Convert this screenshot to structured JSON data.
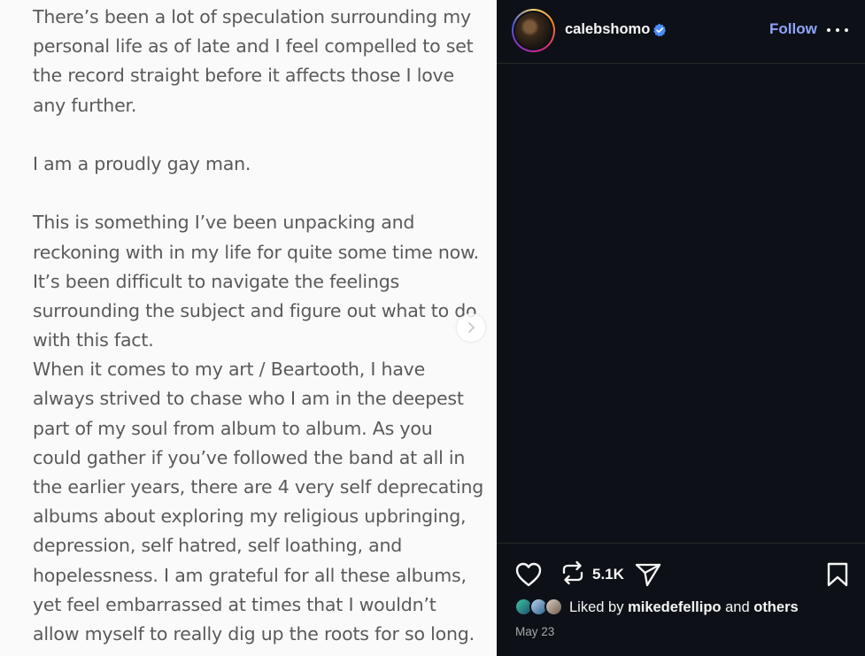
{
  "post": {
    "note_lines": [
      "There’s been a lot of speculation surrounding my",
      "personal life as of late and I feel compelled to set",
      "the record straight before it affects those I love",
      "any further.",
      "",
      "I am a proudly gay man.",
      "",
      "This is something I’ve been unpacking and",
      "reckoning with in my life for quite some time now.",
      "It’s been difficult to navigate the feelings",
      "surrounding the subject and figure out what to do",
      "with this fact.",
      "When it comes to my art / Beartooth, I have",
      "always strived to chase who I am in the deepest",
      "part of my soul from album to album. As you",
      "could gather if you’ve followed the band at all in",
      "the earlier years, there are 4 very self deprecating",
      "albums about exploring my religious upbringing,",
      "depression, self hatred, self loathing, and",
      "hopelessness. I am grateful for all these albums,",
      "yet feel embarrassed at times that I wouldn’t",
      "allow myself to really dig up the roots for so long."
    ],
    "next_icon": "chevron-right-icon"
  },
  "header": {
    "username": "calebshomo",
    "verified_icon": "verified-badge-icon",
    "follow_label": "Follow",
    "more_icon": "more-options-icon"
  },
  "actions": {
    "like_icon": "heart-icon",
    "repost_icon": "repost-icon",
    "repost_count": "5.1K",
    "share_icon": "send-icon",
    "save_icon": "bookmark-icon"
  },
  "likes": {
    "prefix": "Liked by",
    "user": "mikedefellipo",
    "middle": "and",
    "others": "others"
  },
  "date": "May 23",
  "colors": {
    "sidebar_bg": "#0d1117",
    "follow": "#8fa3ff",
    "note_text": "#5a5a5a",
    "verified": "#4a8cf7"
  }
}
